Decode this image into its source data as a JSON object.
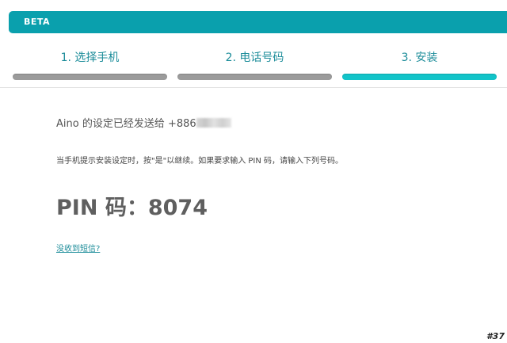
{
  "header": {
    "badge": "BETA",
    "color": "#0aa0ad"
  },
  "steps": [
    {
      "label": "1. 选择手机",
      "state": "completed"
    },
    {
      "label": "2. 电话号码",
      "state": "completed"
    },
    {
      "label": "3. 安装",
      "state": "active"
    }
  ],
  "colors": {
    "step_done": "#9b9b9b",
    "step_active": "#12c4c9",
    "link": "#1d8d9a"
  },
  "main": {
    "sent_text": "Aino 的设定已经发送给 +886",
    "instruction": "当手机提示安装设定时，按\"是\"以继续。如果要求输入 PIN 码，请输入下列号码。",
    "pin_label": "PIN 码：",
    "pin_value": "8074",
    "no_sms_link": "没收到短信?"
  },
  "corner_tag": "#37"
}
